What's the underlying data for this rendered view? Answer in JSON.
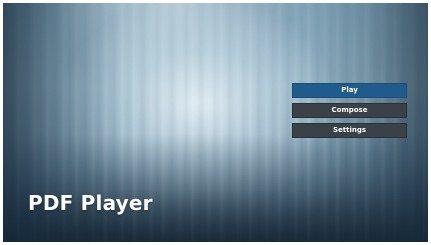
{
  "app": {
    "title": "PDF Player"
  },
  "menu": {
    "items": [
      {
        "label": "Play",
        "selected": true
      },
      {
        "label": "Compose",
        "selected": false
      },
      {
        "label": "Settings",
        "selected": false
      }
    ]
  },
  "colors": {
    "selected_button": "#1f5c8c",
    "button": "#3a4147",
    "text": "#ffffff"
  }
}
